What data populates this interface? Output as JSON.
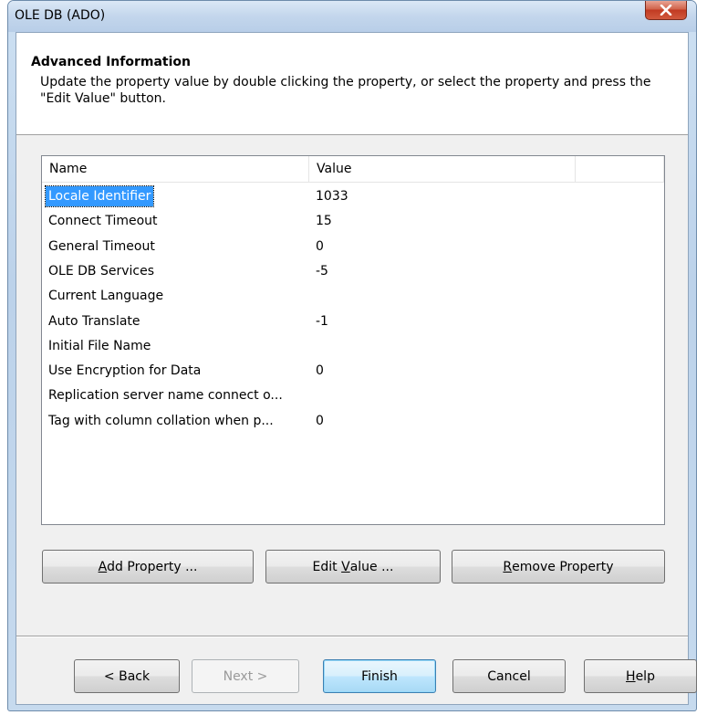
{
  "window": {
    "title": "OLE DB (ADO)"
  },
  "header": {
    "title": "Advanced Information",
    "description": "Update the property value by double clicking the property, or select the property and press the \"Edit Value\" button."
  },
  "list": {
    "columns": [
      "Name",
      "Value",
      ""
    ],
    "rows": [
      {
        "name": "Locale Identifier",
        "value": "1033"
      },
      {
        "name": "Connect Timeout",
        "value": "15"
      },
      {
        "name": "General Timeout",
        "value": "0"
      },
      {
        "name": "OLE DB Services",
        "value": "-5"
      },
      {
        "name": "Current Language",
        "value": ""
      },
      {
        "name": "Auto Translate",
        "value": "-1"
      },
      {
        "name": "Initial File Name",
        "value": ""
      },
      {
        "name": "Use Encryption for Data",
        "value": "0"
      },
      {
        "name": "Replication server name connect o...",
        "value": ""
      },
      {
        "name": "Tag with column collation when p...",
        "value": "0"
      }
    ],
    "selected_index": 0
  },
  "property_buttons": {
    "add_prefix": "",
    "add_mnemonic": "A",
    "add_rest": "dd Property ...",
    "edit_prefix": "Edit ",
    "edit_mnemonic": "V",
    "edit_rest": "alue ...",
    "remove_prefix": "",
    "remove_mnemonic": "R",
    "remove_rest": "emove Property"
  },
  "wizard_buttons": {
    "back": "< Back",
    "next": "Next >",
    "finish": "Finish",
    "cancel": "Cancel",
    "help_mnemonic": "H",
    "help_rest": "elp"
  },
  "colors": {
    "selection": "#3399ff",
    "close_button": "#c13a22"
  }
}
